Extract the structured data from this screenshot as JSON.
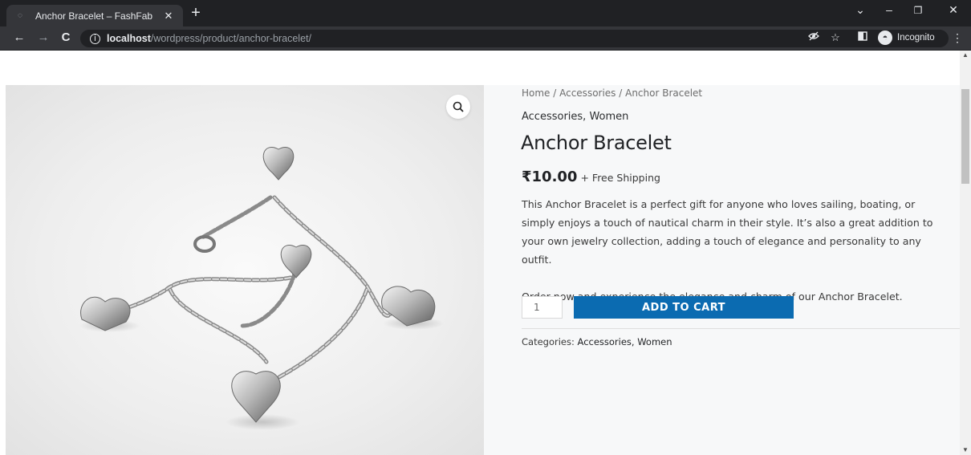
{
  "browser": {
    "tab_title": "Anchor Bracelet – FashFab",
    "tab_close": "✕",
    "new_tab": "+",
    "url_host": "localhost",
    "url_path": "/wordpress/product/anchor-bracelet/",
    "mode_label": "Incognito",
    "icons": [
      "back-icon",
      "forward-icon",
      "reload-icon",
      "info-icon",
      "eye-off-icon",
      "star-icon",
      "side-panel-icon",
      "incognito-icon",
      "menu-icon"
    ]
  },
  "product": {
    "breadcrumb": "Home / Accessories / Anchor Bracelet",
    "categories_top": "Accessories, Women",
    "title": "Anchor Bracelet",
    "price": "₹10.00",
    "shipping": "+ Free Shipping",
    "description": [
      "This Anchor Bracelet is a perfect gift for anyone who loves sailing, boating, or simply enjoys a touch of nautical charm in their style. It’s also a great addition to your own jewelry collection, adding a touch of elegance and personality to any outfit.",
      "Order now and experience the elegance and charm of our Anchor Bracelet."
    ],
    "quantity": "1",
    "add_to_cart_label": "ADD TO CART",
    "meta_label": "Categories:",
    "meta_categories": "Accessories, Women"
  },
  "colors": {
    "button": "#0b6bb1",
    "summary_bg": "#f7f8f9",
    "chrome_dark": "#202124",
    "chrome_toolbar": "#35363a"
  }
}
